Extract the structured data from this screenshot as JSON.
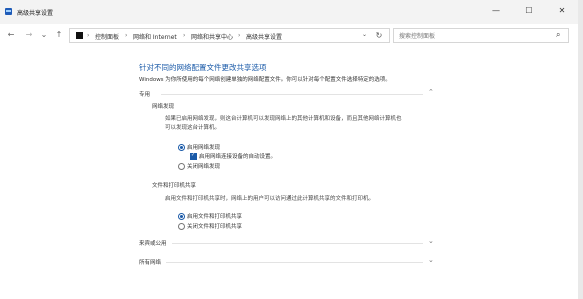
{
  "window": {
    "title": "高级共享设置",
    "controls": {
      "minimize": "—",
      "maximize": "☐",
      "close": "✕"
    }
  },
  "nav": {
    "back": "←",
    "forward": "→",
    "recent": "⌄",
    "up": "↑"
  },
  "address": {
    "breadcrumbs": [
      "控制面板",
      "网络和 Internet",
      "网络和共享中心",
      "高级共享设置"
    ],
    "separator": "›",
    "dropdown": "⌄",
    "refresh": "↻"
  },
  "search": {
    "placeholder": "搜索控制面板",
    "icon": "search-icon"
  },
  "main": {
    "title": "针对不同的网络配置文件更改共享选项",
    "description": "Windows 为你所使用的每个网络创建单独的网络配置文件。你可以针对每个配置文件选择特定的选项。",
    "sections": {
      "private": {
        "label": "专用",
        "network_discovery": {
          "label": "网络发现",
          "description_line1": "如果已启用网络发现，则这台计算机可以发现网络上的其他计算机和设备，而且其他网络计算机也",
          "description_line2": "可以发现这台计算机。",
          "opt_on": "启用网络发现",
          "opt_auto": "启用网络连接设备的自动设置。",
          "opt_off": "关闭网络发现",
          "selected": "on",
          "auto_checked": true
        },
        "file_sharing": {
          "label": "文件和打印机共享",
          "description": "启用文件和打印机共享时，网络上的用户可以访问通过此计算机共享的文件和打印机。",
          "opt_on": "启用文件和打印机共享",
          "opt_off": "关闭文件和打印机共享",
          "selected": "on"
        }
      },
      "guest": {
        "label": "来宾或公用"
      },
      "all": {
        "label": "所有网络"
      }
    },
    "chevron_up": "⌃",
    "chevron_down": "⌄"
  },
  "colors": {
    "accent": "#1a5aa8",
    "titlebar": "#f3f3f3",
    "border": "#d6d6d6"
  }
}
